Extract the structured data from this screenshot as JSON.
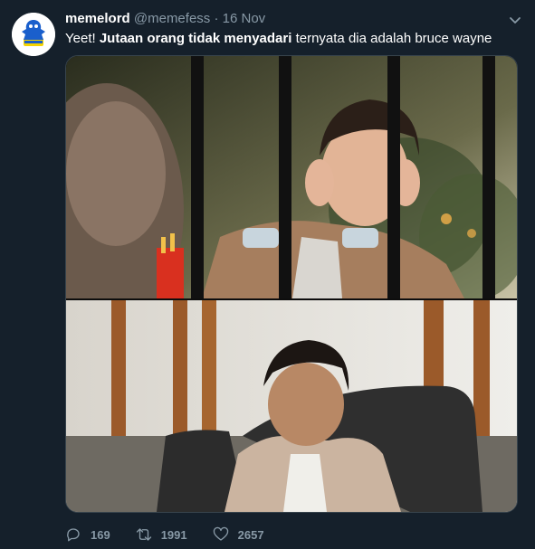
{
  "tweet": {
    "author_name": "memelord",
    "author_handle": "@memefess",
    "separator": "·",
    "timestamp": "16 Nov",
    "text_pre": "Yeet! ",
    "text_bold": "Jutaan orang tidak menyadari",
    "text_post": " ternyata dia adalah bruce wayne",
    "replies": "169",
    "retweets": "1991",
    "likes": "2657"
  },
  "icons": {
    "avatar": "blue-mascot-avatar",
    "menu": "chevron-down-icon",
    "reply": "reply-icon",
    "retweet": "retweet-icon",
    "like": "heart-icon"
  },
  "colors": {
    "background": "#15202b",
    "secondary_text": "#8899a6",
    "border": "#38444d"
  }
}
